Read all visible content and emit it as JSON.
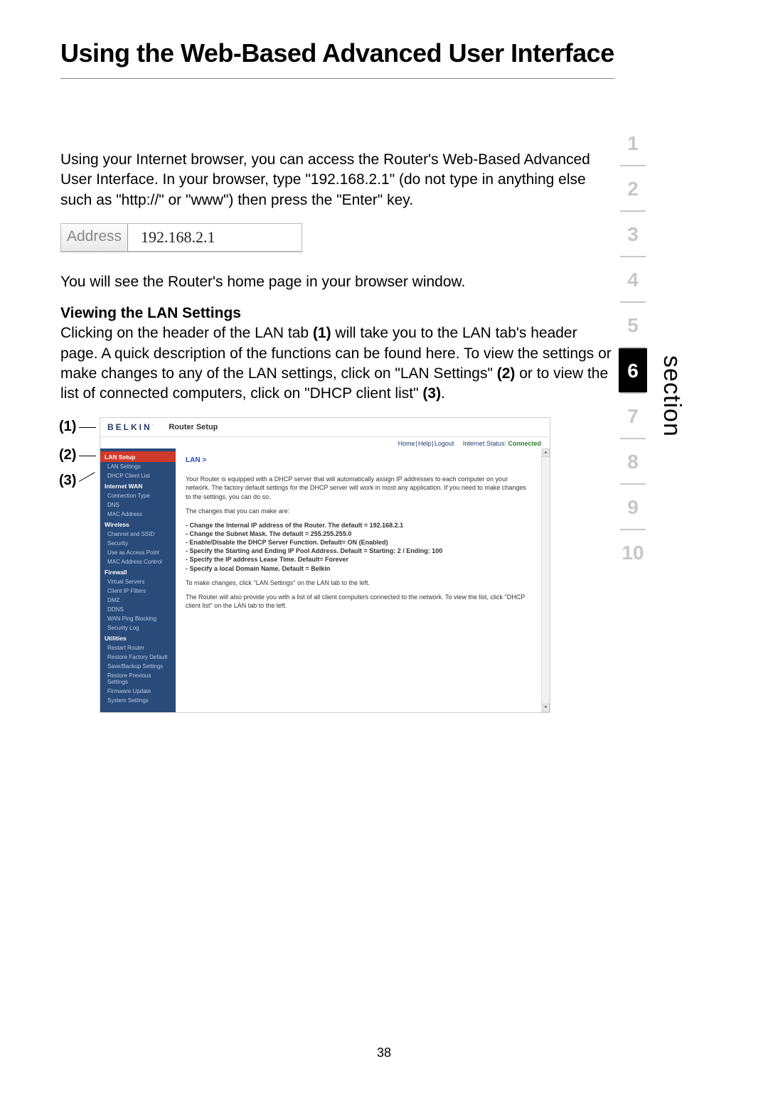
{
  "page_title": "Using the Web-Based Advanced User Interface",
  "para1": "Using your Internet browser, you can access the Router's Web-Based Advanced User Interface. In your browser, type \"192.168.2.1\" (do not type in anything else such as \"http://\" or \"www\") then press the \"Enter\" key.",
  "address_label": "Address",
  "address_value": "192.168.2.1",
  "para2": "You will see the Router's home page in your browser window.",
  "sub_heading": "Viewing the LAN Settings",
  "para3_parts": {
    "a": "Clicking on the header of the LAN tab ",
    "b1": "(1)",
    "c": " will take you to the LAN tab's header page. A quick description of the functions can be found here. To view the settings or make changes to any of the LAN settings, click on \"LAN Settings\" ",
    "b2": "(2)",
    "d": " or to view the list of connected computers, click on \"DHCP client list\" ",
    "b3": "(3)",
    "e": "."
  },
  "section_nav": [
    "1",
    "2",
    "3",
    "4",
    "5",
    "6",
    "7",
    "8",
    "9",
    "10"
  ],
  "section_active": "6",
  "section_label": "section",
  "page_number": "38",
  "callouts": {
    "c1": "(1)",
    "c2": "(2)",
    "c3": "(3)"
  },
  "shot": {
    "brand": "BELKIN",
    "brand_sub": ".",
    "router_setup": "Router Setup",
    "top_links": {
      "home": "Home",
      "help": "Help",
      "logout": "Logout",
      "status_label": "Internet Status:",
      "status_value": "Connected"
    },
    "sidebar": [
      {
        "type": "grp_hot",
        "text": "LAN Setup"
      },
      {
        "type": "itm",
        "text": "LAN Settings"
      },
      {
        "type": "itm",
        "text": "DHCP Client List"
      },
      {
        "type": "grp",
        "text": "Internet WAN"
      },
      {
        "type": "itm",
        "text": "Connection Type"
      },
      {
        "type": "itm",
        "text": "DNS"
      },
      {
        "type": "itm",
        "text": "MAC Address"
      },
      {
        "type": "grp",
        "text": "Wireless"
      },
      {
        "type": "itm",
        "text": "Channel and SSID"
      },
      {
        "type": "itm",
        "text": "Security"
      },
      {
        "type": "itm",
        "text": "Use as Access Point"
      },
      {
        "type": "itm",
        "text": "MAC Address Control"
      },
      {
        "type": "grp",
        "text": "Firewall"
      },
      {
        "type": "itm",
        "text": "Virtual Servers"
      },
      {
        "type": "itm",
        "text": "Client IP Filters"
      },
      {
        "type": "itm",
        "text": "DMZ"
      },
      {
        "type": "itm",
        "text": "DDNS"
      },
      {
        "type": "itm",
        "text": "WAN Ping Blocking"
      },
      {
        "type": "itm",
        "text": "Security Log"
      },
      {
        "type": "grp",
        "text": "Utilities"
      },
      {
        "type": "itm",
        "text": "Restart Router"
      },
      {
        "type": "itm",
        "text": "Restore Factory Default"
      },
      {
        "type": "itm",
        "text": "Save/Backup Settings"
      },
      {
        "type": "itm",
        "text": "Restore Previous Settings"
      },
      {
        "type": "itm",
        "text": "Firmware Update"
      },
      {
        "type": "itm",
        "text": "System Settings"
      }
    ],
    "panel": {
      "breadcrumb": "LAN >",
      "p1": "Your Router is equipped with a DHCP server that will automatically assign IP addresses to each computer on your network. The factory default settings for the DHCP server will work in most any application. If you need to make changes to the settings, you can do so.",
      "p2": "The changes that you can make are:",
      "b1": "- Change the Internal IP address of the Router. The default = 192.168.2.1",
      "b2": "- Change the Subnet Mask. The default = 255.255.255.0",
      "b3": "- Enable/Disable the DHCP Server Function. Default= ON (Enabled)",
      "b4": "- Specify the Starting and Ending IP Pool Address. Default = Starting: 2 / Ending: 100",
      "b5": "- Specify the IP address Lease Time. Default= Forever",
      "b6": "- Specify a local Domain Name. Default = Belkin",
      "p3": "To make changes, click \"LAN Settings\" on the LAN tab to the left.",
      "p4": "The Router will also provide you with a list of all client computers connected to the network. To view the list, click \"DHCP client list\" on the LAN tab to the left."
    }
  }
}
